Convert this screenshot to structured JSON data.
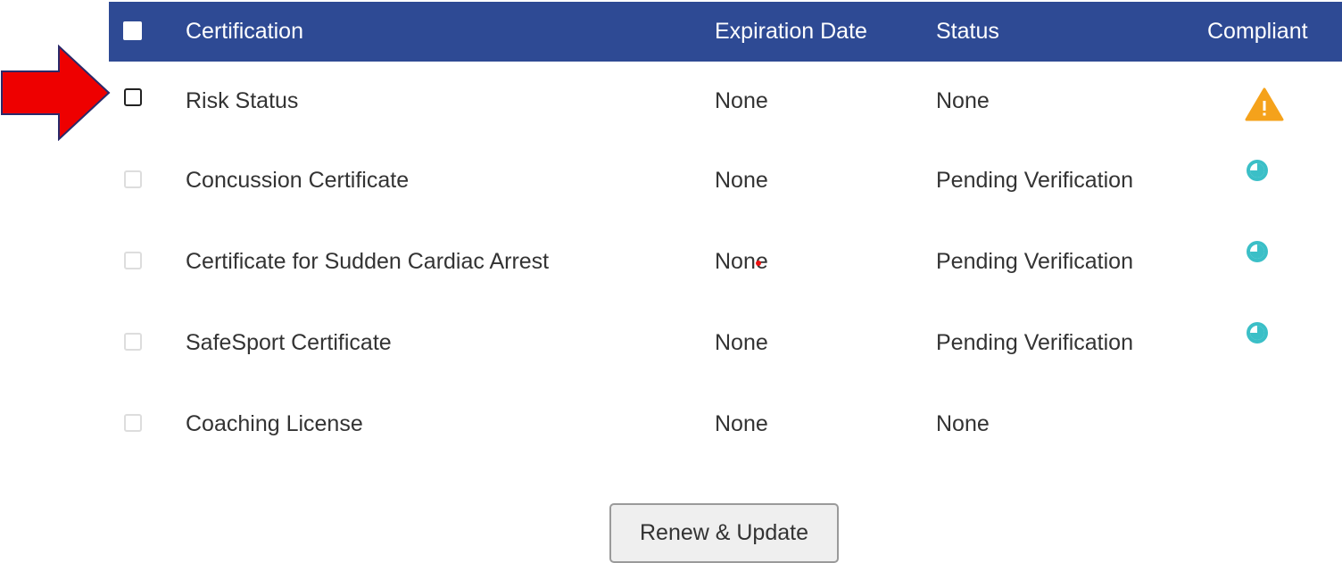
{
  "table": {
    "headers": {
      "certification": "Certification",
      "expiration_date": "Expiration Date",
      "status": "Status",
      "compliant": "Compliant"
    },
    "rows": [
      {
        "certification": "Risk Status",
        "expiration_date": "None",
        "status": "None",
        "compliant_icon": "warning-icon",
        "checkbox_enabled": true
      },
      {
        "certification": "Concussion Certificate",
        "expiration_date": "None",
        "status": "Pending Verification",
        "compliant_icon": "clock-icon",
        "checkbox_enabled": false
      },
      {
        "certification": "Certificate for Sudden Cardiac Arrest",
        "expiration_date": "None",
        "status": "Pending Verification",
        "compliant_icon": "clock-icon",
        "checkbox_enabled": false
      },
      {
        "certification": "SafeSport Certificate",
        "expiration_date": "None",
        "status": "Pending Verification",
        "compliant_icon": "clock-icon",
        "checkbox_enabled": false
      },
      {
        "certification": "Coaching License",
        "expiration_date": "None",
        "status": "None",
        "compliant_icon": "",
        "checkbox_enabled": false
      }
    ]
  },
  "actions": {
    "renew_update_label": "Renew & Update"
  },
  "colors": {
    "header_bg": "#2e4a94",
    "warning": "#f5a21b",
    "pending": "#3bbfc7",
    "annotation_arrow": "#ee0000"
  }
}
